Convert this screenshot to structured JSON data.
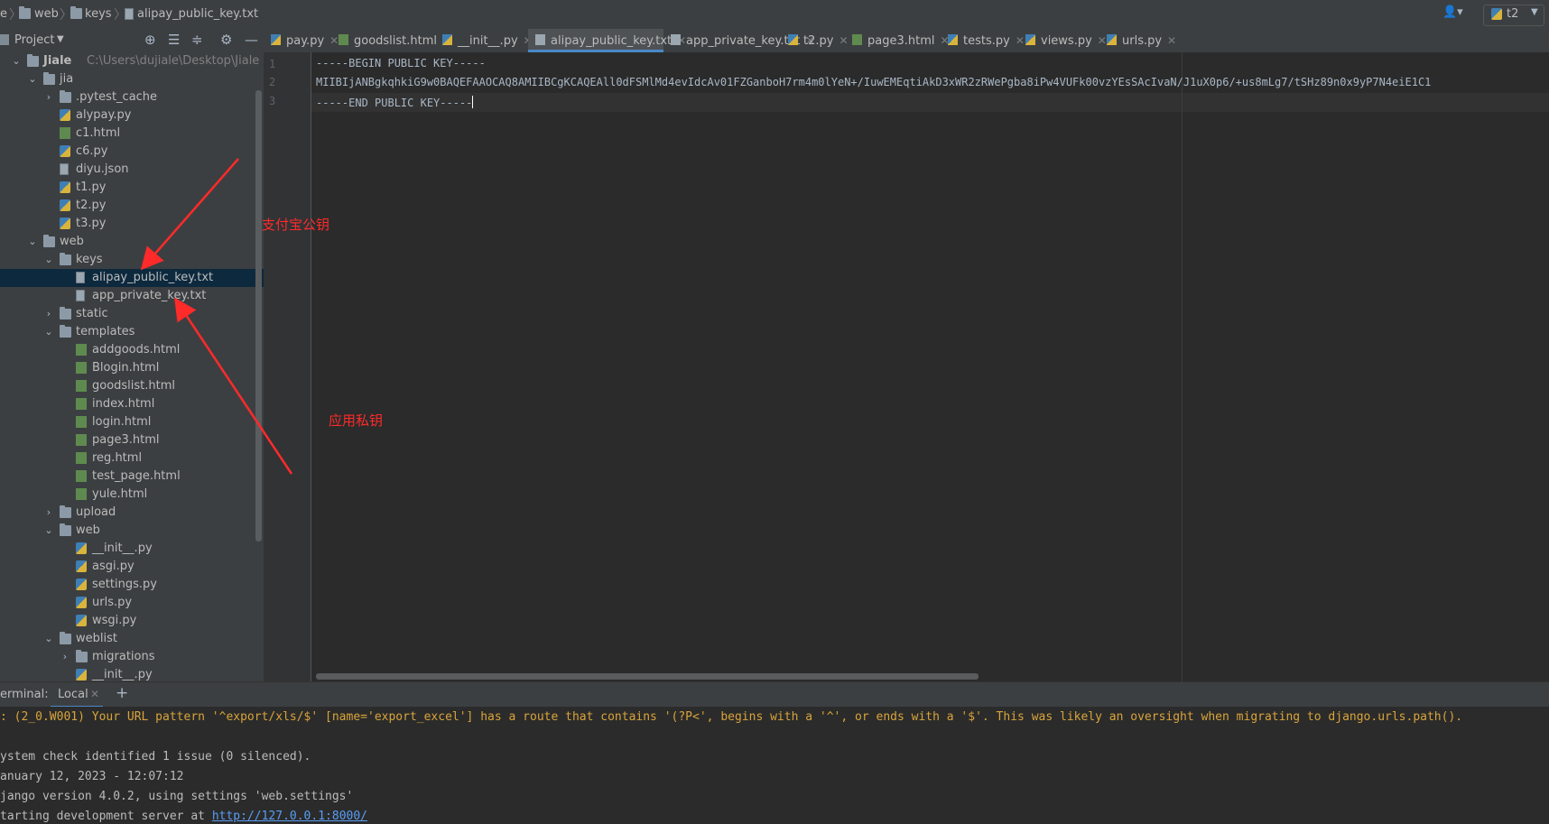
{
  "breadcrumb": [
    "e",
    "web",
    "keys",
    "alipay_public_key.txt"
  ],
  "run_config": {
    "label": "t2"
  },
  "project_panel": {
    "title": "Project"
  },
  "tree": [
    {
      "label": "Jiale",
      "path": "C:\\Users\\dujiale\\Desktop\\Jiale",
      "type": "folder",
      "open": true,
      "depth": 0
    },
    {
      "label": "jia",
      "type": "folder",
      "open": true,
      "depth": 1
    },
    {
      "label": ".pytest_cache",
      "type": "folder",
      "open": false,
      "depth": 2
    },
    {
      "label": "alypay.py",
      "type": "py",
      "depth": 2
    },
    {
      "label": "c1.html",
      "type": "html",
      "depth": 2
    },
    {
      "label": "c6.py",
      "type": "py",
      "depth": 2
    },
    {
      "label": "diyu.json",
      "type": "file",
      "depth": 2
    },
    {
      "label": "t1.py",
      "type": "py",
      "depth": 2
    },
    {
      "label": "t2.py",
      "type": "py",
      "depth": 2
    },
    {
      "label": "t3.py",
      "type": "py",
      "depth": 2
    },
    {
      "label": "web",
      "type": "folder",
      "open": true,
      "depth": 1
    },
    {
      "label": "keys",
      "type": "folder",
      "open": true,
      "depth": 2
    },
    {
      "label": "alipay_public_key.txt",
      "type": "file",
      "depth": 3,
      "selected": true
    },
    {
      "label": "app_private_key.txt",
      "type": "file",
      "depth": 3
    },
    {
      "label": "static",
      "type": "folder",
      "open": false,
      "depth": 2
    },
    {
      "label": "templates",
      "type": "folder",
      "open": true,
      "depth": 2
    },
    {
      "label": "addgoods.html",
      "type": "html",
      "depth": 3
    },
    {
      "label": "Blogin.html",
      "type": "html",
      "depth": 3
    },
    {
      "label": "goodslist.html",
      "type": "html",
      "depth": 3
    },
    {
      "label": "index.html",
      "type": "html",
      "depth": 3
    },
    {
      "label": "login.html",
      "type": "html",
      "depth": 3
    },
    {
      "label": "page3.html",
      "type": "html",
      "depth": 3
    },
    {
      "label": "reg.html",
      "type": "html",
      "depth": 3
    },
    {
      "label": "test_page.html",
      "type": "html",
      "depth": 3
    },
    {
      "label": "yule.html",
      "type": "html",
      "depth": 3
    },
    {
      "label": "upload",
      "type": "folder",
      "open": false,
      "depth": 2
    },
    {
      "label": "web",
      "type": "folder",
      "open": true,
      "depth": 2
    },
    {
      "label": "__init__.py",
      "type": "py",
      "depth": 3
    },
    {
      "label": "asgi.py",
      "type": "py",
      "depth": 3
    },
    {
      "label": "settings.py",
      "type": "py",
      "depth": 3
    },
    {
      "label": "urls.py",
      "type": "py",
      "depth": 3
    },
    {
      "label": "wsgi.py",
      "type": "py",
      "depth": 3
    },
    {
      "label": "weblist",
      "type": "folder",
      "open": true,
      "depth": 2
    },
    {
      "label": "migrations",
      "type": "folder",
      "open": false,
      "depth": 3
    },
    {
      "label": "__init__.py",
      "type": "py",
      "depth": 3
    }
  ],
  "tabs": [
    {
      "label": "pay.py",
      "type": "py"
    },
    {
      "label": "goodslist.html",
      "type": "html"
    },
    {
      "label": "__init__.py",
      "type": "py"
    },
    {
      "label": "alipay_public_key.txt",
      "type": "file",
      "active": true
    },
    {
      "label": "app_private_key.txt",
      "type": "file"
    },
    {
      "label": "t2.py",
      "type": "py"
    },
    {
      "label": "page3.html",
      "type": "html"
    },
    {
      "label": "tests.py",
      "type": "py"
    },
    {
      "label": "views.py",
      "type": "py"
    },
    {
      "label": "urls.py",
      "type": "py"
    }
  ],
  "editor": {
    "line_numbers": [
      "1",
      "2",
      "3"
    ],
    "lines": [
      "-----BEGIN PUBLIC KEY-----",
      "MIIBIjANBgkqhkiG9w0BAQEFAAOCAQ8AMIIBCgKCAQEAll0dFSMlMd4evIdcAv01FZGanboH7rm4m0lYeN+/IuwEMEqtiAkD3xWR2zRWePgba8iPw4VUFk00vzYEsSAcIvaN/J1uX0p6/+us8mLg7/tSHz89n0x9yP7N4eiE1C1",
      "-----END PUBLIC KEY-----"
    ]
  },
  "annotations": {
    "public_key": "支付宝公钥",
    "private_key": "应用私钥"
  },
  "terminal": {
    "title": "erminal:",
    "tab": "Local",
    "lines": [
      ": (2_0.W001) Your URL pattern '^export/xls/$' [name='export_excel'] has a route that contains '(?P<', begins with a '^', or ends with a '$'. This was likely an oversight when migrating to django.urls.path().",
      "",
      "ystem check identified 1 issue (0 silenced).",
      "anuary 12, 2023 - 12:07:12",
      "jango version 4.0.2, using settings 'web.settings'"
    ],
    "server_prefix": "tarting development server at ",
    "server_url": "http://127.0.0.1:8000/"
  },
  "colors": {
    "accent": "#4a88c7",
    "annotation": "#ff2a2a",
    "warning": "#d9a43a",
    "link": "#589df6",
    "selection": "#0d293e"
  }
}
